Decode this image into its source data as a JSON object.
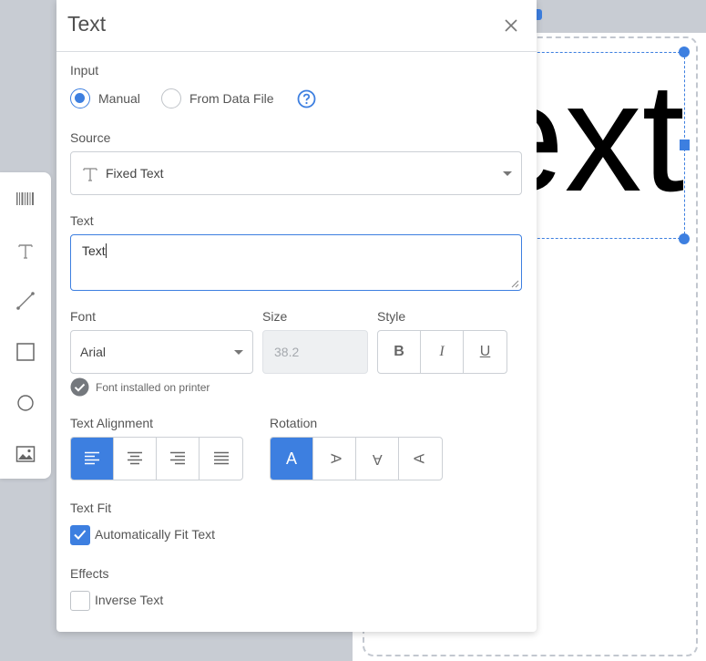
{
  "canvas": {
    "preview_text": "Text"
  },
  "panel": {
    "title": "Text",
    "input": {
      "label": "Input",
      "options": [
        {
          "label": "Manual",
          "checked": true
        },
        {
          "label": "From Data File",
          "checked": false
        }
      ]
    },
    "source": {
      "label": "Source",
      "value": "Fixed Text"
    },
    "text": {
      "label": "Text",
      "value": "Text"
    },
    "font": {
      "label": "Font",
      "value": "Arial",
      "note": "Font installed on printer"
    },
    "size": {
      "label": "Size",
      "placeholder": "38.2"
    },
    "style": {
      "label": "Style",
      "bold": "B",
      "italic": "I",
      "underline": "U"
    },
    "alignment": {
      "label": "Text Alignment",
      "selected": "left"
    },
    "rotation": {
      "label": "Rotation",
      "symbol": "A",
      "selected": "0"
    },
    "text_fit": {
      "label": "Text Fit",
      "checkbox_label": "Automatically Fit Text",
      "checked": true
    },
    "effects": {
      "label": "Effects",
      "checkbox_label": "Inverse Text",
      "checked": false
    }
  },
  "toolbar": {
    "tools": [
      "barcode-icon",
      "text-icon",
      "line-icon",
      "rectangle-icon",
      "ellipse-icon",
      "image-icon"
    ]
  },
  "colors": {
    "accent": "#3d7fe0",
    "background": "#c8ccd3"
  }
}
